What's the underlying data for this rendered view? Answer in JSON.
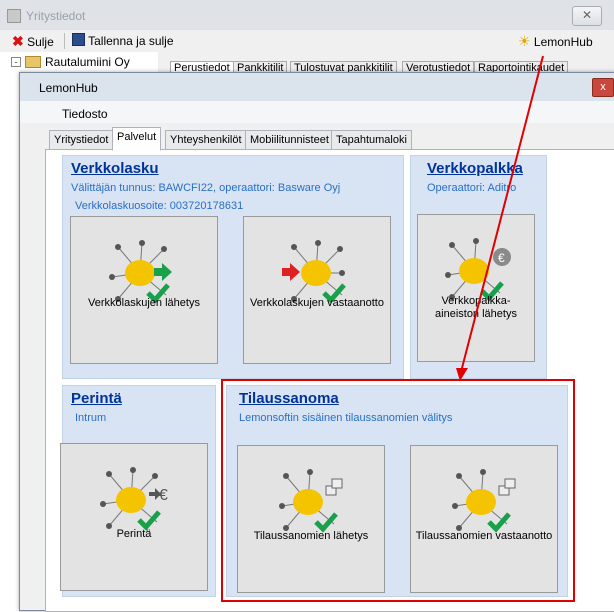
{
  "bg_window": {
    "title": "Yritystiedot",
    "close_glyph": "✕",
    "toolbar": {
      "close_label": "Sulje",
      "save_close_label": "Tallenna ja sulje",
      "lemonhub_label": "LemonHub"
    },
    "tree": {
      "root_label": "Rautalumiini Oy"
    },
    "tabs": [
      "Perustiedot",
      "Pankkitilit",
      "Tulostuvat pankkitilit",
      "Verotustiedot",
      "Raportointikaudet"
    ]
  },
  "dialog": {
    "title": "LemonHub",
    "close_glyph": "x",
    "menu": {
      "file": "Tiedosto"
    },
    "tabs": [
      "Yritystiedot",
      "Palvelut",
      "Yhteyshenkilöt",
      "Mobiilitunnisteet",
      "Tapahtumaloki"
    ],
    "active_tab": "Palvelut",
    "groups": {
      "verkkolasku": {
        "title": "Verkkolasku",
        "line1": "Välittäjän tunnus: BAWCFI22, operaattori: Basware Oyj",
        "line2": "Verkkolaskuosoite: 003720178631",
        "tiles": [
          "Verkkolaskujen lähetys",
          "Verkkolaskujen vastaanotto"
        ]
      },
      "verkkopalkka": {
        "title": "Verkkopalkka",
        "line1": "Operaattori: Aditro",
        "tiles": [
          "Verkkopalkka-aineiston lähetys"
        ]
      },
      "perinta": {
        "title": "Perintä",
        "line1": "Intrum",
        "tiles": [
          "Perintä"
        ]
      },
      "tilaussanoma": {
        "title": "Tilaussanoma",
        "line1": "Lemonsoftin sisäinen tilaussanomien välitys",
        "tiles": [
          "Tilaussanomien lähetys",
          "Tilaussanomien vastaanotto"
        ]
      }
    }
  },
  "colors": {
    "annotation": "#e00000",
    "group_bg": "#d8e4f3",
    "title_blue": "#003399",
    "info_blue": "#2a6fc6"
  }
}
